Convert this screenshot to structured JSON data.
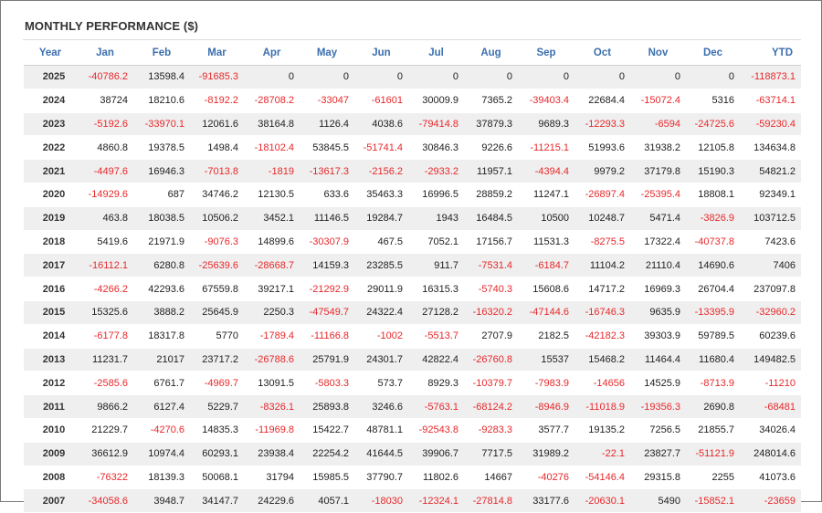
{
  "title": "MONTHLY PERFORMANCE ($)",
  "colors": {
    "header_text": "#3b6fae",
    "negative": "#e8282b",
    "positive": "#222222",
    "stripe": "#efefef"
  },
  "columns": [
    "Year",
    "Jan",
    "Feb",
    "Mar",
    "Apr",
    "May",
    "Jun",
    "Jul",
    "Aug",
    "Sep",
    "Oct",
    "Nov",
    "Dec",
    "YTD"
  ],
  "chart_data": {
    "type": "table",
    "title": "MONTHLY PERFORMANCE ($)",
    "columns": [
      "Year",
      "Jan",
      "Feb",
      "Mar",
      "Apr",
      "May",
      "Jun",
      "Jul",
      "Aug",
      "Sep",
      "Oct",
      "Nov",
      "Dec",
      "YTD"
    ],
    "rows": [
      [
        "2025",
        "-40786.2",
        "13598.4",
        "-91685.3",
        "0",
        "0",
        "0",
        "0",
        "0",
        "0",
        "0",
        "0",
        "0",
        "-118873.1"
      ],
      [
        "2024",
        "38724",
        "18210.6",
        "-8192.2",
        "-28708.2",
        "-33047",
        "-61601",
        "30009.9",
        "7365.2",
        "-39403.4",
        "22684.4",
        "-15072.4",
        "5316",
        "-63714.1"
      ],
      [
        "2023",
        "-5192.6",
        "-33970.1",
        "12061.6",
        "38164.8",
        "1126.4",
        "4038.6",
        "-79414.8",
        "37879.3",
        "9689.3",
        "-12293.3",
        "-6594",
        "-24725.6",
        "-59230.4"
      ],
      [
        "2022",
        "4860.8",
        "19378.5",
        "1498.4",
        "-18102.4",
        "53845.5",
        "-51741.4",
        "30846.3",
        "9226.6",
        "-11215.1",
        "51993.6",
        "31938.2",
        "12105.8",
        "134634.8"
      ],
      [
        "2021",
        "-4497.6",
        "16946.3",
        "-7013.8",
        "-1819",
        "-13617.3",
        "-2156.2",
        "-2933.2",
        "11957.1",
        "-4394.4",
        "9979.2",
        "37179.8",
        "15190.3",
        "54821.2"
      ],
      [
        "2020",
        "-14929.6",
        "687",
        "34746.2",
        "12130.5",
        "633.6",
        "35463.3",
        "16996.5",
        "28859.2",
        "11247.1",
        "-26897.4",
        "-25395.4",
        "18808.1",
        "92349.1"
      ],
      [
        "2019",
        "463.8",
        "18038.5",
        "10506.2",
        "3452.1",
        "11146.5",
        "19284.7",
        "1943",
        "16484.5",
        "10500",
        "10248.7",
        "5471.4",
        "-3826.9",
        "103712.5"
      ],
      [
        "2018",
        "5419.6",
        "21971.9",
        "-9076.3",
        "14899.6",
        "-30307.9",
        "467.5",
        "7052.1",
        "17156.7",
        "11531.3",
        "-8275.5",
        "17322.4",
        "-40737.8",
        "7423.6"
      ],
      [
        "2017",
        "-16112.1",
        "6280.8",
        "-25639.6",
        "-28668.7",
        "14159.3",
        "23285.5",
        "911.7",
        "-7531.4",
        "-6184.7",
        "11104.2",
        "21110.4",
        "14690.6",
        "7406"
      ],
      [
        "2016",
        "-4266.2",
        "42293.6",
        "67559.8",
        "39217.1",
        "-21292.9",
        "29011.9",
        "16315.3",
        "-5740.3",
        "15608.6",
        "14717.2",
        "16969.3",
        "26704.4",
        "237097.8"
      ],
      [
        "2015",
        "15325.6",
        "3888.2",
        "25645.9",
        "2250.3",
        "-47549.7",
        "24322.4",
        "27128.2",
        "-16320.2",
        "-47144.6",
        "-16746.3",
        "9635.9",
        "-13395.9",
        "-32960.2"
      ],
      [
        "2014",
        "-6177.8",
        "18317.8",
        "5770",
        "-1789.4",
        "-11166.8",
        "-1002",
        "-5513.7",
        "2707.9",
        "2182.5",
        "-42182.3",
        "39303.9",
        "59789.5",
        "60239.6"
      ],
      [
        "2013",
        "11231.7",
        "21017",
        "23717.2",
        "-26788.6",
        "25791.9",
        "24301.7",
        "42822.4",
        "-26760.8",
        "15537",
        "15468.2",
        "11464.4",
        "11680.4",
        "149482.5"
      ],
      [
        "2012",
        "-2585.6",
        "6761.7",
        "-4969.7",
        "13091.5",
        "-5803.3",
        "573.7",
        "8929.3",
        "-10379.7",
        "-7983.9",
        "-14656",
        "14525.9",
        "-8713.9",
        "-11210"
      ],
      [
        "2011",
        "9866.2",
        "6127.4",
        "5229.7",
        "-8326.1",
        "25893.8",
        "3246.6",
        "-5763.1",
        "-68124.2",
        "-8946.9",
        "-11018.9",
        "-19356.3",
        "2690.8",
        "-68481"
      ],
      [
        "2010",
        "21229.7",
        "-4270.6",
        "14835.3",
        "-11969.8",
        "15422.7",
        "48781.1",
        "-92543.8",
        "-9283.3",
        "3577.7",
        "19135.2",
        "7256.5",
        "21855.7",
        "34026.4"
      ],
      [
        "2009",
        "36612.9",
        "10974.4",
        "60293.1",
        "23938.4",
        "22254.2",
        "41644.5",
        "39906.7",
        "7717.5",
        "31989.2",
        "-22.1",
        "23827.7",
        "-51121.9",
        "248014.6"
      ],
      [
        "2008",
        "-76322",
        "18139.3",
        "50068.1",
        "31794",
        "15985.5",
        "37790.7",
        "11802.6",
        "14667",
        "-40276",
        "-54146.4",
        "29315.8",
        "2255",
        "41073.6"
      ],
      [
        "2007",
        "-34058.6",
        "3948.7",
        "34147.7",
        "24229.6",
        "4057.1",
        "-18030",
        "-12324.1",
        "-27814.8",
        "33177.6",
        "-20630.1",
        "5490",
        "-15852.1",
        "-23659"
      ]
    ]
  }
}
